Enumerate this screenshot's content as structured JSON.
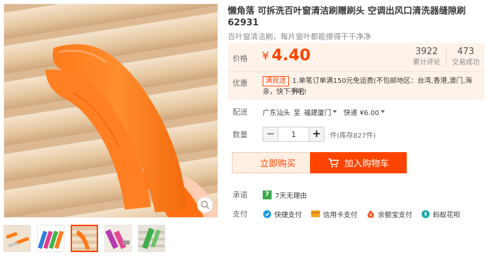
{
  "product": {
    "title": "懒角落 可拆洗百叶窗清洁刷赠刷头 空调出风口清洗器缝隙刷62931",
    "subtitle": "百叶窗清洁刷，每片窗叶都能擦得干干净净"
  },
  "gallery": {
    "thumbnail_count": 5,
    "active_thumbnail": 3
  },
  "price": {
    "label": "价格",
    "currency": "¥",
    "value": "4.40"
  },
  "stats": {
    "reviews_count": "3922",
    "reviews_label": "累计评论",
    "sales_count": "473",
    "sales_label": "交易成功"
  },
  "promo": {
    "label": "优惠",
    "tag": "满就送",
    "text_line1": "1.单笔订单满150元免运费(不包邮地区：台湾,香港,澳门,海外)；",
    "text_line2": "亲，快下手吧!"
  },
  "shipping": {
    "label": "配送",
    "from": "广东汕头",
    "to_word": "至",
    "destination": "福建厦门",
    "method": "快递 ¥6.00"
  },
  "quantity": {
    "label": "数量",
    "minus": "−",
    "value": "1",
    "plus": "+",
    "stock": "件(库存827件)"
  },
  "actions": {
    "buy_now": "立即购买",
    "add_to_cart": "加入购物车"
  },
  "promise": {
    "label": "承诺",
    "badge": "7",
    "text": "7天无理由"
  },
  "payment": {
    "label": "支付",
    "methods": [
      "快捷支付",
      "信用卡支付",
      "余额宝支付",
      "蚂蚁花呗"
    ]
  },
  "colors": {
    "accent": "#ff4400",
    "price_bg": "#fff2e8",
    "buy_bg": "#ffeee2",
    "promise_green": "#3aa94b"
  },
  "icons": {
    "zoom": "magnifier-icon",
    "cart": "cart-icon",
    "pay_quick": "quick-pay-icon",
    "pay_credit": "credit-card-icon",
    "pay_yuebao": "yuebao-icon",
    "pay_huabei": "huabei-icon"
  }
}
